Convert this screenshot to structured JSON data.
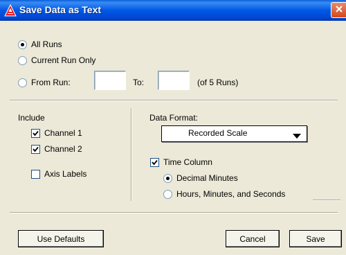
{
  "window": {
    "title": "Save Data as Text",
    "close_icon": "close-x-icon",
    "app_icon": "app-a-icon"
  },
  "run_selection": {
    "all_runs": "All Runs",
    "current_run_only": "Current Run Only",
    "from_run": "From Run:",
    "to": "To:",
    "of_runs": "(of 5 Runs)",
    "selected": "All Runs",
    "from_value": "",
    "to_value": ""
  },
  "include": {
    "heading": "Include",
    "channel1": {
      "label": "Channel 1",
      "checked": true
    },
    "channel2": {
      "label": "Channel 2",
      "checked": true
    },
    "axis_labels": {
      "label": "Axis Labels",
      "checked": false
    }
  },
  "format": {
    "heading": "Data Format:",
    "dropdown_value": "Recorded Scale",
    "time_column": {
      "label": "Time Column",
      "checked": true
    },
    "decimal_minutes": "Decimal Minutes",
    "hms": "Hours, Minutes, and Seconds",
    "selected_time_format": "Decimal Minutes"
  },
  "buttons": {
    "use_defaults": "Use Defaults",
    "cancel": "Cancel",
    "save": "Save"
  },
  "colors": {
    "title_bar": "#0058e6",
    "dialog_bg": "#ece9d8",
    "close_button": "#d2481b"
  }
}
